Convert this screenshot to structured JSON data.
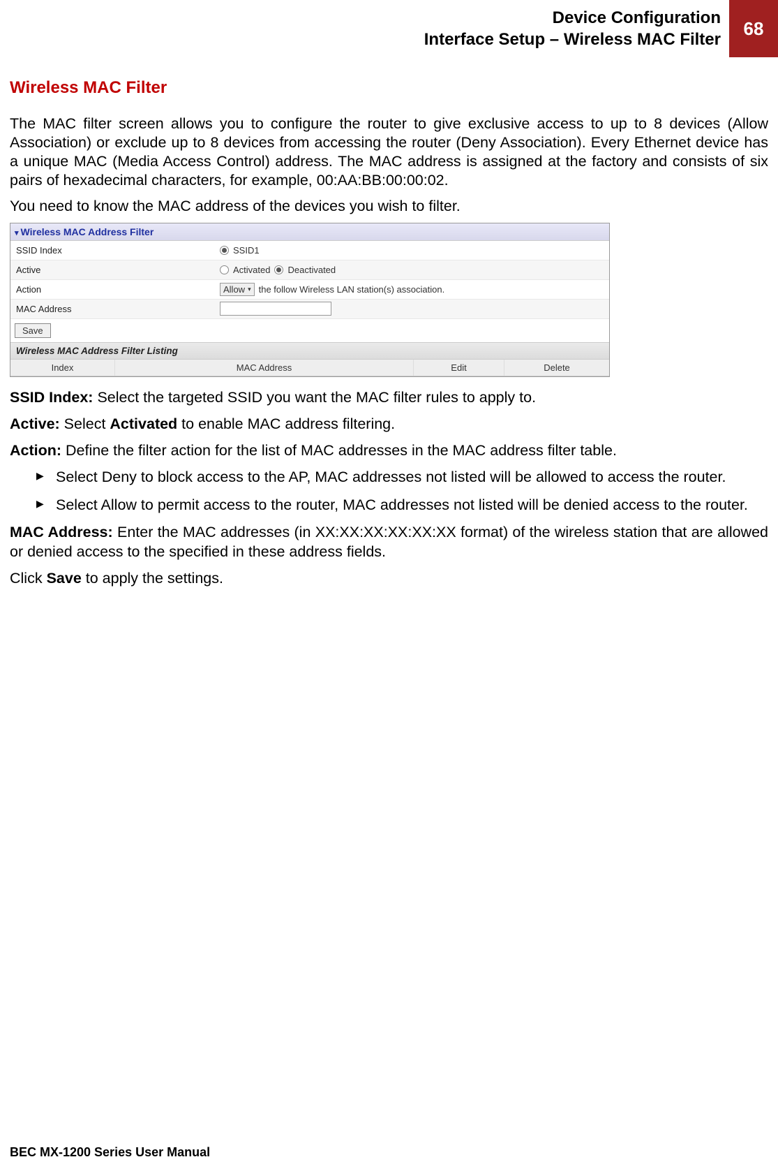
{
  "header": {
    "line1": "Device Configuration",
    "line2": "Interface Setup – Wireless MAC Filter",
    "page": "68"
  },
  "title": "Wireless MAC Filter",
  "intro1": "The MAC filter screen allows you to configure the router to give exclusive access to up to 8 devices (Allow Association) or exclude up to 8 devices from accessing the router (Deny Association). Every Ethernet device has a unique MAC (Media Access Control) address. The MAC address is assigned at the factory and consists of six pairs of hexadecimal characters, for example, 00:AA:BB:00:00:02.",
  "intro2": "You need to know the MAC address of the devices you wish to filter.",
  "screenshot": {
    "panel_title": "Wireless MAC Address Filter",
    "rows": {
      "ssid_label": "SSID Index",
      "ssid_value": "SSID1",
      "active_label": "Active",
      "active_opt1": "Activated",
      "active_opt2": "Deactivated",
      "action_label": "Action",
      "action_select": "Allow",
      "action_text": "the follow Wireless LAN station(s) association.",
      "mac_label": "MAC Address"
    },
    "save": "Save",
    "listing_title": "Wireless MAC Address Filter Listing",
    "cols": {
      "index": "Index",
      "mac": "MAC Address",
      "edit": "Edit",
      "delete": "Delete"
    }
  },
  "defs": {
    "ssid_bold": "SSID Index: ",
    "ssid_text": "Select the targeted SSID you want the MAC filter rules to apply to.",
    "active_bold": "Active: ",
    "active_text1": "Select ",
    "active_text_bold": "Activated",
    "active_text2": " to enable MAC address filtering.",
    "action_bold": "Action: ",
    "action_text": "Define the filter action for the list of MAC addresses in the MAC address filter table.",
    "bullet1_a": "Select ",
    "bullet1_bold": "Deny",
    "bullet1_b": " to block access to the AP, MAC addresses not listed will be allowed to access the router.",
    "bullet2_a": "Select ",
    "bullet2_bold": "Allow",
    "bullet2_b": " to permit access to the router, MAC addresses not listed will be denied access to the router.",
    "mac_bold": "MAC Address: ",
    "mac_text": "Enter the MAC addresses (in XX:XX:XX:XX:XX:XX format) of the wireless station that are allowed or denied access to the specified in these address fields.",
    "save_a": "Click ",
    "save_bold": "Save",
    "save_b": " to apply the settings."
  },
  "footer": "BEC MX-1200 Series User Manual"
}
